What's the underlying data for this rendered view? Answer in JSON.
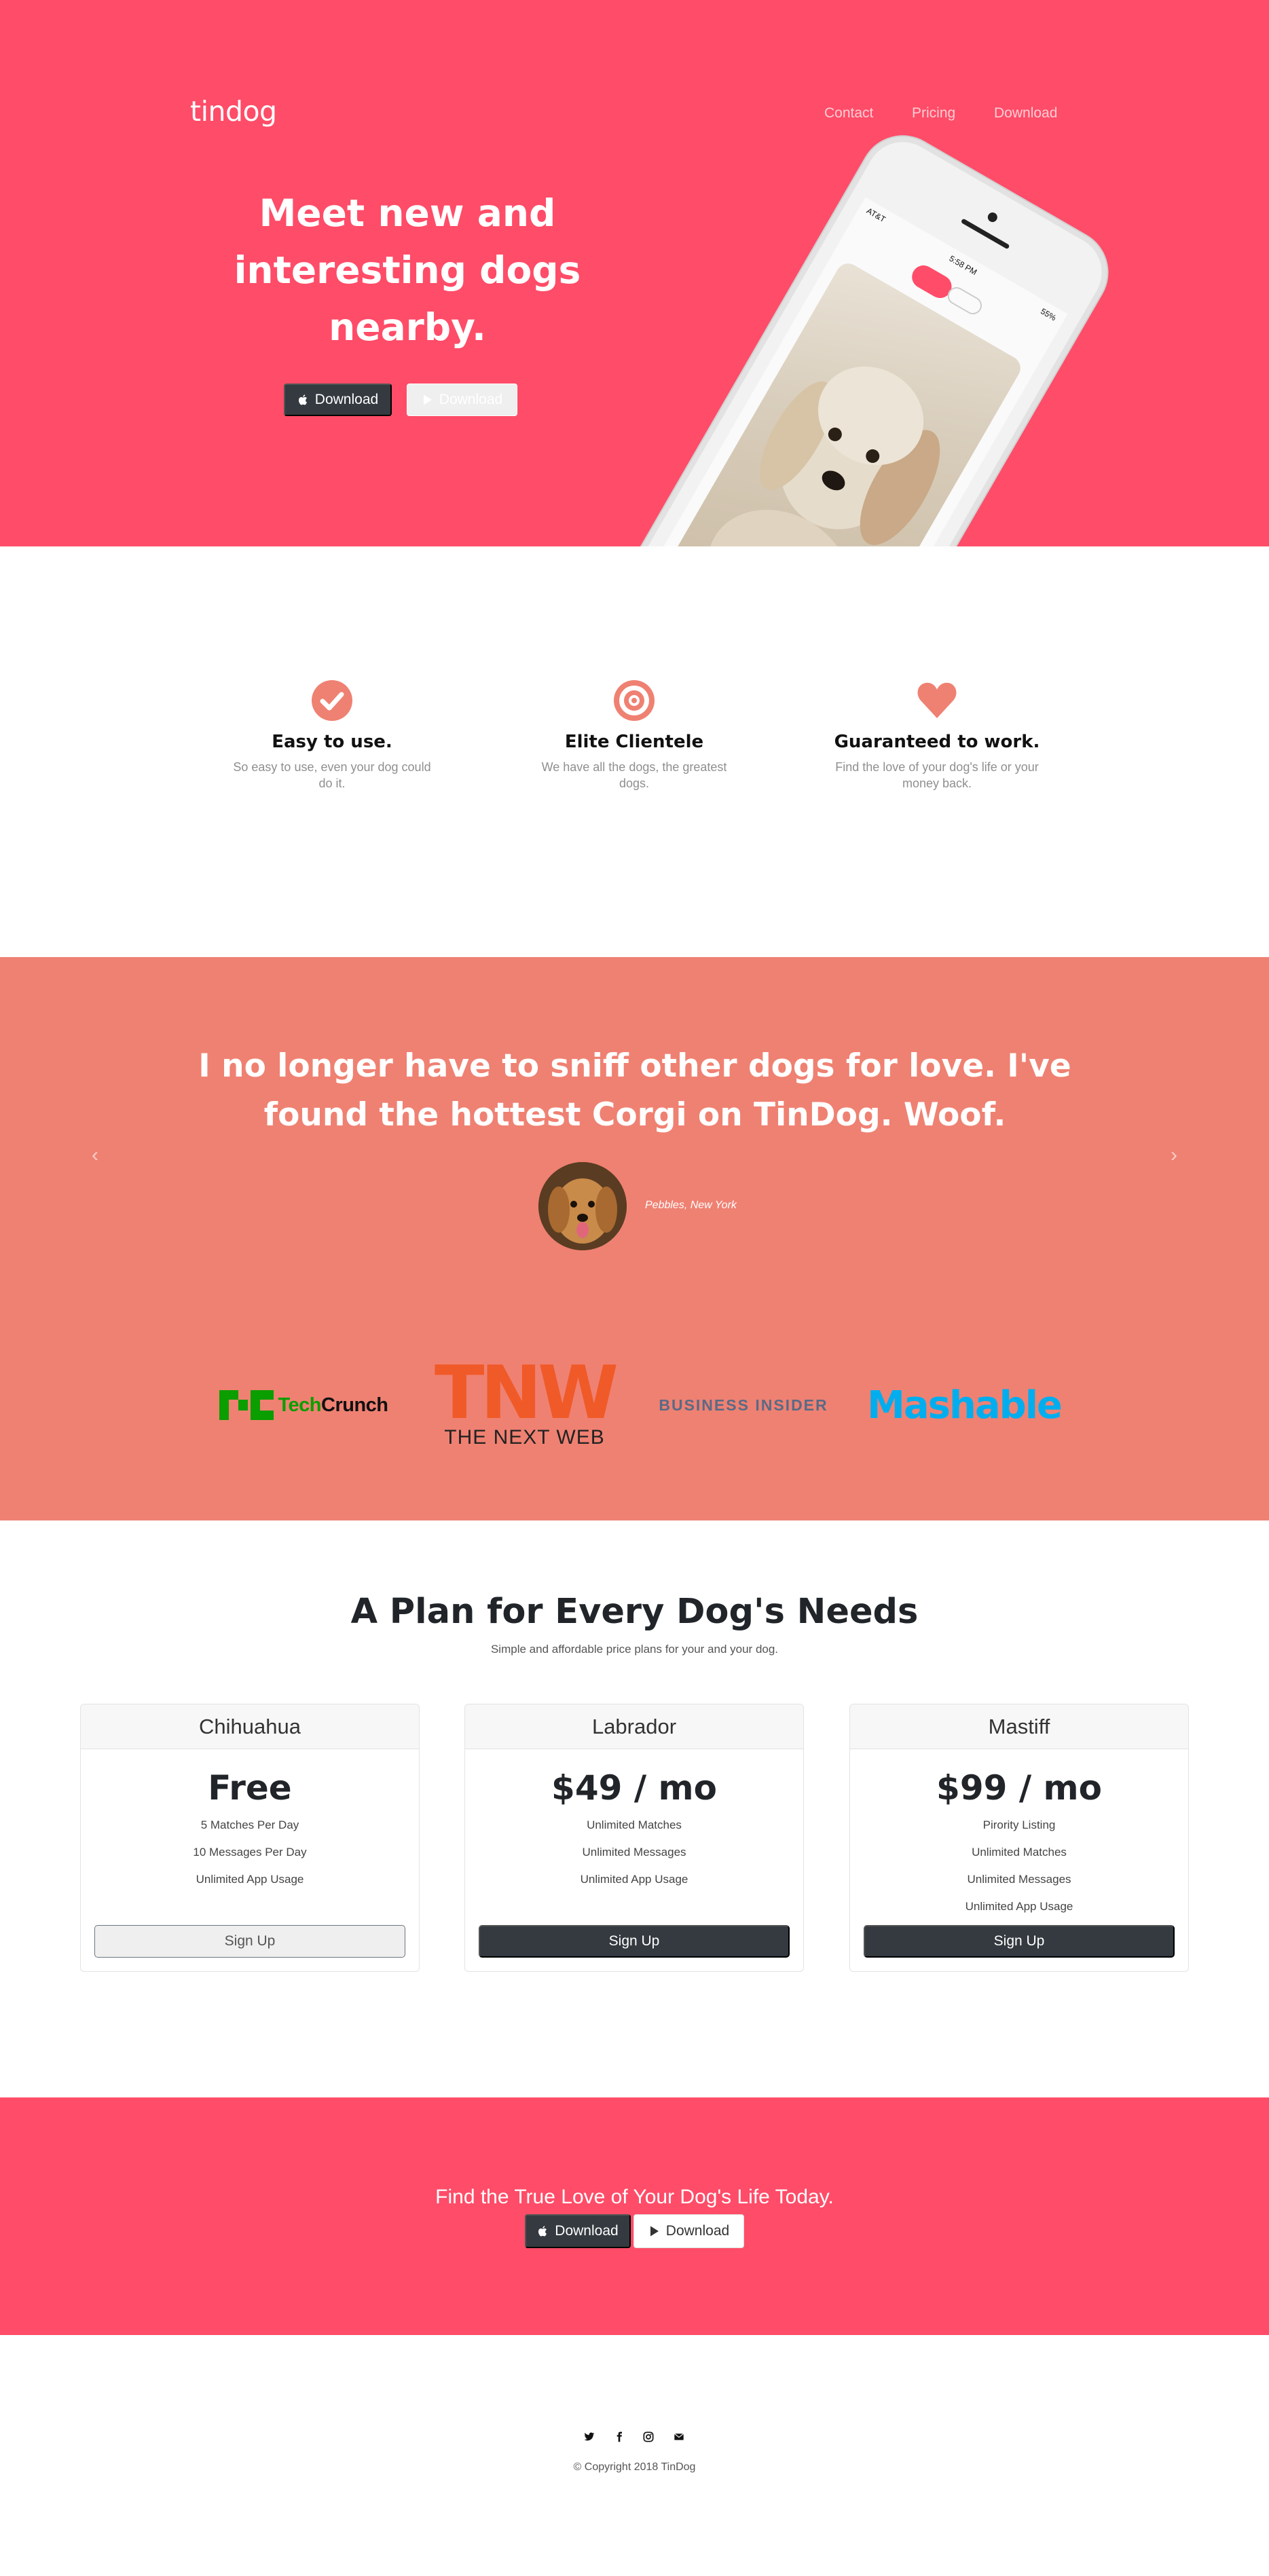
{
  "colors": {
    "primary": "#ff4c68",
    "coral": "#ef8172",
    "dark_button": "#343a40",
    "feature_icon": "#ef8172"
  },
  "nav": {
    "brand": "tindog",
    "links": [
      "Contact",
      "Pricing",
      "Download"
    ]
  },
  "hero": {
    "title": "Meet new and interesting dogs nearby.",
    "download_apple": "Download",
    "download_play": "Download",
    "phone_status": {
      "carrier": "AT&T",
      "time": "5:58 PM",
      "battery": "55%"
    }
  },
  "features": [
    {
      "icon": "check-circle-icon",
      "title": "Easy to use.",
      "text": "So easy to use, even your dog could do it."
    },
    {
      "icon": "bullseye-icon",
      "title": "Elite Clientele",
      "text": "We have all the dogs, the greatest dogs."
    },
    {
      "icon": "heart-icon",
      "title": "Guaranteed to work.",
      "text": "Find the love of your dog's life or your money back."
    }
  ],
  "testimonial": {
    "quote": "I no longer have to sniff other dogs for love. I've found the hottest Corgi on TinDog. Woof.",
    "author": "Pebbles, New York",
    "prev": "‹",
    "next": "›"
  },
  "press": {
    "techcrunch": "TechCrunch",
    "tnw_logo": "TNW",
    "tnw_caption": "THE NEXT WEB",
    "business_insider": "BUSINESS INSIDER",
    "mashable": "Mashable"
  },
  "pricing": {
    "title": "A Plan for Every Dog's Needs",
    "subtitle": "Simple and affordable price plans for your and your dog.",
    "plans": [
      {
        "name": "Chihuahua",
        "price": "Free",
        "features": [
          "5 Matches Per Day",
          "10 Messages Per Day",
          "Unlimited App Usage"
        ],
        "button": "Sign Up"
      },
      {
        "name": "Labrador",
        "price": "$49 / mo",
        "features": [
          "Unlimited Matches",
          "Unlimited Messages",
          "Unlimited App Usage"
        ],
        "button": "Sign Up"
      },
      {
        "name": "Mastiff",
        "price": "$99 / mo",
        "features": [
          "Pirority Listing",
          "Unlimited Matches",
          "Unlimited Messages",
          "Unlimited App Usage"
        ],
        "button": "Sign Up"
      }
    ]
  },
  "cta": {
    "text": "Find the True Love of Your Dog's Life Today.",
    "download_apple": "Download",
    "download_play": "Download"
  },
  "footer": {
    "social_icons": [
      "twitter-icon",
      "facebook-icon",
      "instagram-icon",
      "envelope-icon"
    ],
    "copyright": "© Copyright 2018 TinDog"
  }
}
